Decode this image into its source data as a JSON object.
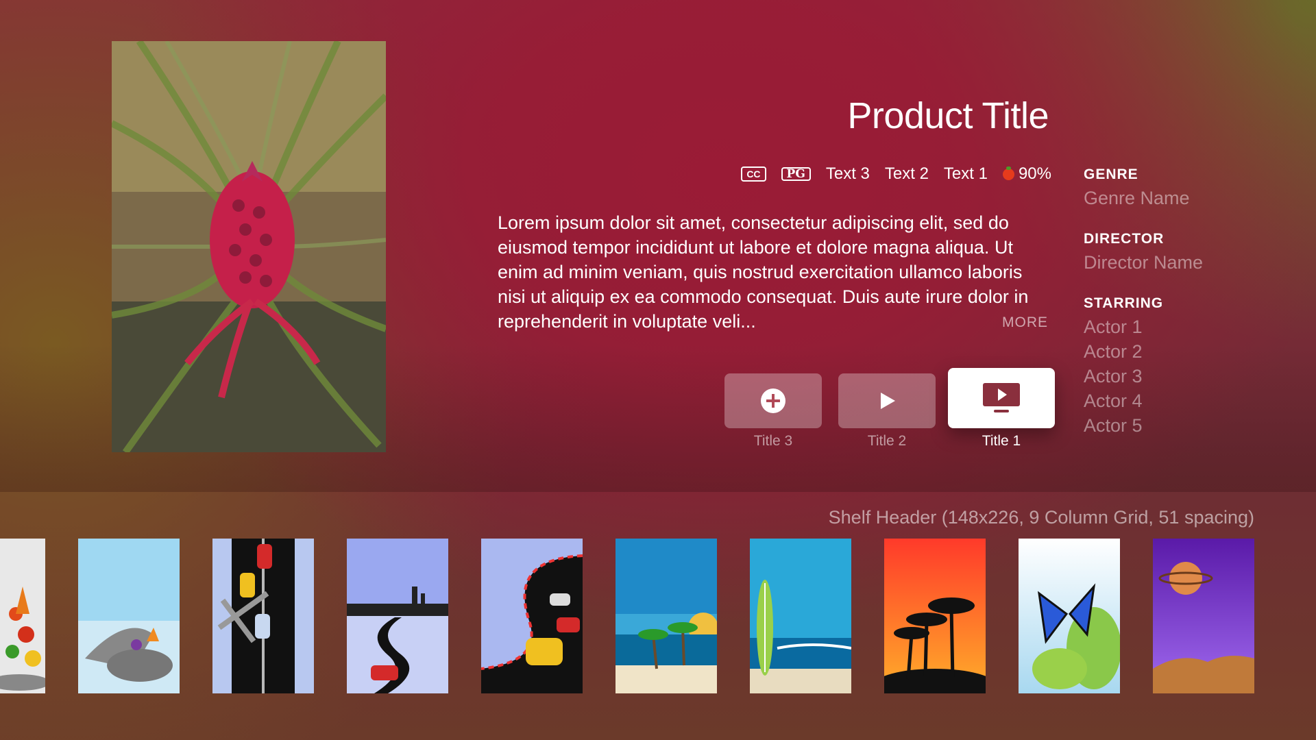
{
  "product": {
    "title": "Product Title",
    "badges": {
      "cc": "CC",
      "pg": "PG"
    },
    "meta_text": [
      "Text 3",
      "Text 2",
      "Text 1"
    ],
    "rating": "90%",
    "description": "Lorem ipsum dolor sit amet, consectetur adipiscing elit, sed do eiusmod tempor incididunt ut labore et dolore magna aliqua. Ut enim ad minim veniam, quis nostrud exercitation ullamco laboris nisi ut aliquip ex ea commodo consequat. Duis aute irure dolor in reprehenderit in voluptate veli...",
    "more_label": "MORE"
  },
  "buttons": [
    {
      "label": "Title 3",
      "icon": "plus-circle-icon"
    },
    {
      "label": "Title 2",
      "icon": "play-icon"
    },
    {
      "label": "Title 1",
      "icon": "tv-play-icon",
      "focused": true
    }
  ],
  "info": {
    "genre_header": "GENRE",
    "genre": "Genre Name",
    "director_header": "DIRECTOR",
    "director": "Director Name",
    "starring_header": "STARRING",
    "actors": [
      "Actor 1",
      "Actor 2",
      "Actor 3",
      "Actor 4",
      "Actor 5"
    ]
  },
  "shelf": {
    "header": "Shelf Header (148x226, 9 Column Grid, 51 spacing)",
    "items": [
      "vegetables",
      "grill",
      "race-track",
      "city-road",
      "racing-curve",
      "beach-hammock",
      "surfboard-beach",
      "palm-sunset",
      "butterfly",
      "planet-space"
    ]
  },
  "colors": {
    "background": "#8f1e36",
    "button": "#c0616f",
    "focused_button": "#ffffff",
    "icon": "#8a2f3d"
  }
}
